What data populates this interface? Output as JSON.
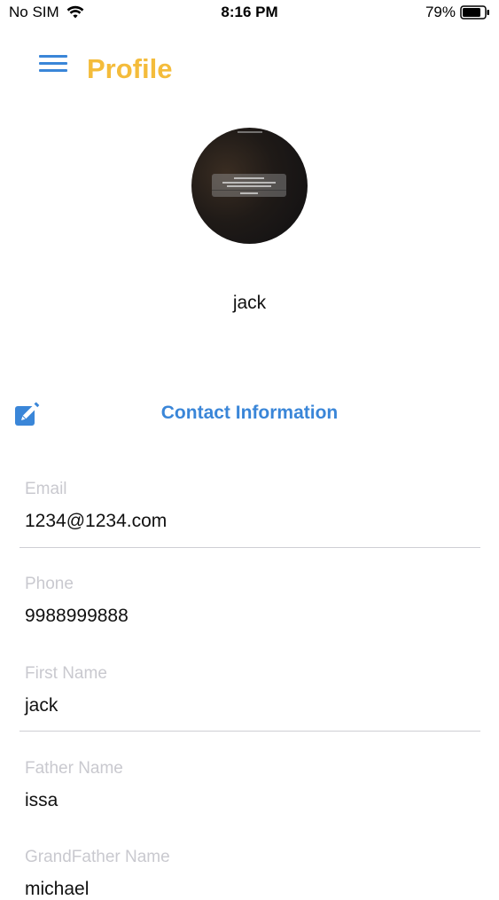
{
  "status_bar": {
    "carrier": "No SIM",
    "time": "8:16 PM",
    "battery": "79%"
  },
  "header": {
    "title": "Profile",
    "menu_icon": "hamburger-menu-icon"
  },
  "profile": {
    "name": "jack"
  },
  "section": {
    "title": "Contact Information",
    "edit_icon": "edit-icon"
  },
  "fields": [
    {
      "label": "Email",
      "value": "1234@1234.com"
    },
    {
      "label": "Phone",
      "value": "9988999888"
    },
    {
      "label": "First Name",
      "value": "jack"
    },
    {
      "label": "Father Name",
      "value": "issa"
    },
    {
      "label": "GrandFather Name",
      "value": "michael"
    }
  ],
  "colors": {
    "accent_blue": "#3a86d8",
    "title_yellow": "#f4bc3b",
    "label_gray": "#c9c9cf"
  }
}
